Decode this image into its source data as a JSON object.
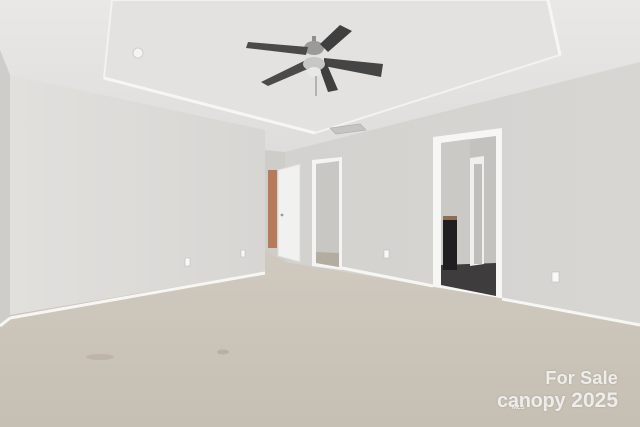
{
  "scene": {
    "description_colors": {
      "ceiling": "#e6e5e3",
      "wall_left": "#dcdad7",
      "wall_right": "#d5d3d0",
      "carpet": "#cbc4b9",
      "baseboard": "#f4f4f2",
      "fan_metal": "#8e8e8e",
      "fan_blade": "#4a4a4a"
    },
    "icons": [
      "ceiling-fan-icon",
      "smoke-detector-icon",
      "air-vent-icon",
      "outlet-icon"
    ]
  },
  "watermark": {
    "line1": "For Sale",
    "brand": "canopy",
    "year": "2025",
    "sub": "MLS"
  }
}
